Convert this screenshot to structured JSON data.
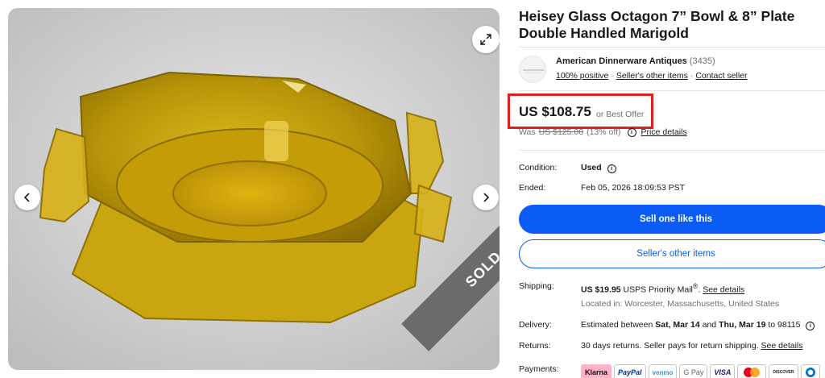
{
  "listing": {
    "title": "Heisey Glass Octagon 7” Bowl & 8” Plate Double Handled Marigold",
    "sold_ribbon": "SOLD"
  },
  "seller": {
    "name": "American Dinnerware Antiques",
    "feedback_count": "(3435)",
    "positive": "100% positive",
    "other_items_link": "Seller's other items",
    "contact_link": "Contact seller"
  },
  "price": {
    "current": "US $108.75",
    "best_offer": "or Best Offer",
    "was_label": "Was",
    "was_price": "US $125.00",
    "discount": "(13% off)",
    "details_link": "Price details",
    "highlight_color": "#e0201f"
  },
  "details": {
    "condition_label": "Condition:",
    "condition_value": "Used",
    "ended_label": "Ended:",
    "ended_value": "Feb 05, 2026 18:09:53 PST"
  },
  "actions": {
    "sell_one": "Sell one like this",
    "seller_other_items": "Seller's other items",
    "primary_color": "#0a5cf5"
  },
  "shipping": {
    "label": "Shipping:",
    "price": "US $19.95",
    "service": "USPS Priority Mail",
    "service_mark": "®",
    "details_link": "See details",
    "location": "Located in: Worcester, Massachusetts, United States"
  },
  "delivery": {
    "label": "Delivery:",
    "prefix": "Estimated between",
    "start": "Sat, Mar 14",
    "and": "and",
    "end": "Thu, Mar 19",
    "suffix": "to 98115"
  },
  "returns": {
    "label": "Returns:",
    "text": "30 days returns. Seller pays for return shipping.",
    "details_link": "See details"
  },
  "payments": {
    "label": "Payments:",
    "methods": [
      "Klarna",
      "PayPal",
      "venmo",
      "G Pay",
      "VISA",
      "Mastercard",
      "DISCOVER",
      "Diners"
    ]
  },
  "icons": {
    "expand": "expand-icon",
    "prev": "chevron-left-icon",
    "next": "chevron-right-icon",
    "info": "info-icon"
  }
}
